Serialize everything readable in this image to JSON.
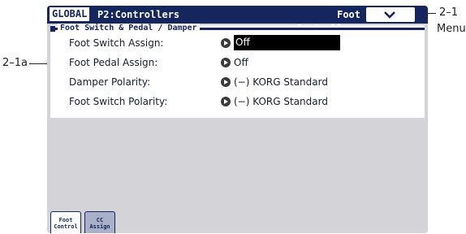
{
  "header": {
    "mode": "GLOBAL",
    "page": "P2:Controllers",
    "section_title": "Foot Controllers"
  },
  "section": {
    "title": "Foot Switch & Pedal / Damper"
  },
  "params": [
    {
      "label": "Foot Switch Assign:",
      "value": "Off",
      "selected": true
    },
    {
      "label": "Foot Pedal Assign:",
      "value": "Off",
      "selected": false
    },
    {
      "label": "Damper Polarity:",
      "value": "(−) KORG Standard",
      "selected": false
    },
    {
      "label": "Foot Switch Polarity:",
      "value": "(−) KORG Standard",
      "selected": false
    }
  ],
  "tabs": [
    {
      "line1": "Foot",
      "line2": "Control",
      "active": true
    },
    {
      "line1": "CC",
      "line2": "Assign",
      "active": false
    }
  ],
  "annotations": {
    "menu_number": "2–1",
    "menu_label": "Menu",
    "pedal_callout": "2–1a"
  },
  "icons": {
    "menu": "chevron-down-icon",
    "value_arrow": "arrow-right-icon"
  }
}
